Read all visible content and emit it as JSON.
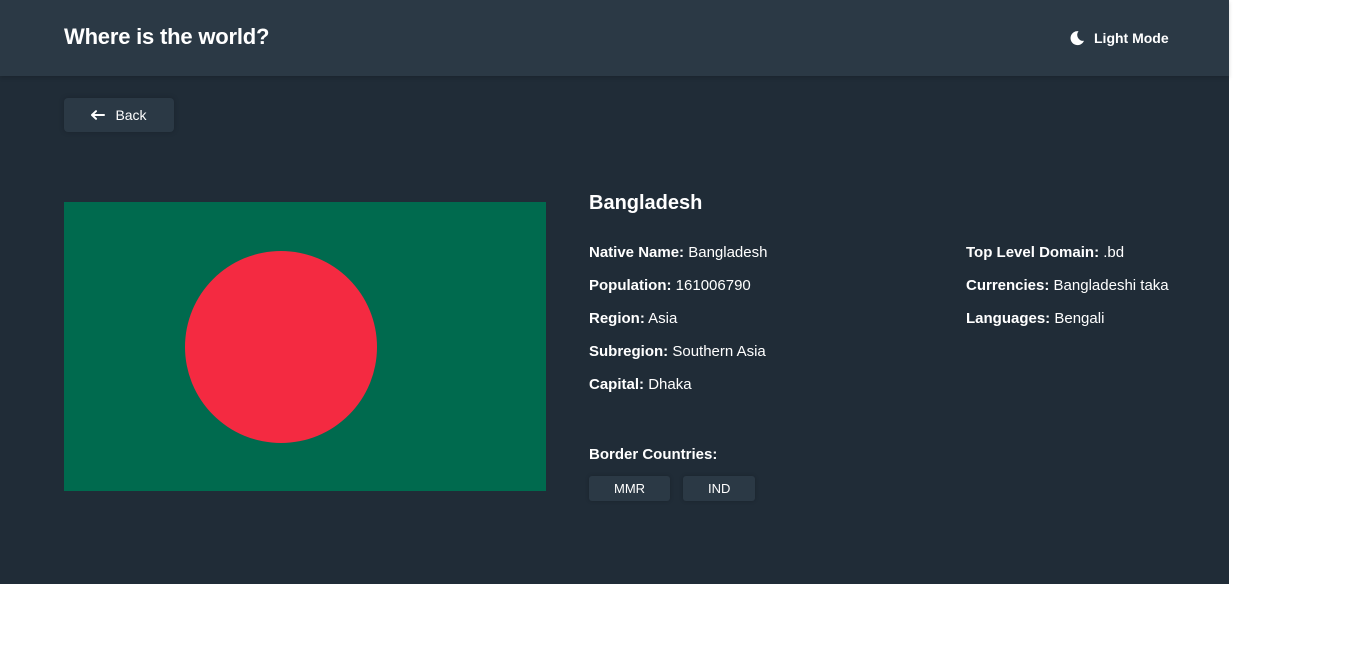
{
  "header": {
    "title": "Where is the world?",
    "mode_label": "Light Mode",
    "mode_icon": "moon-icon"
  },
  "back_button": {
    "label": "Back",
    "icon": "arrow-left-icon"
  },
  "country": {
    "name": "Bangladesh",
    "flag_colors": {
      "field": "#006a4e",
      "disc": "#f42a41"
    },
    "left_details": [
      {
        "key": "Native Name:",
        "value": "Bangladesh"
      },
      {
        "key": "Population:",
        "value": "161006790"
      },
      {
        "key": "Region:",
        "value": "Asia"
      },
      {
        "key": "Subregion:",
        "value": "Southern Asia"
      },
      {
        "key": "Capital:",
        "value": "Dhaka"
      }
    ],
    "right_details": [
      {
        "key": "Top Level Domain:",
        "value": ".bd"
      },
      {
        "key": "Currencies:",
        "value": "Bangladeshi taka"
      },
      {
        "key": "Languages:",
        "value": "Bengali"
      }
    ],
    "border_label": "Border Countries:",
    "borders": [
      "MMR",
      "IND"
    ]
  },
  "colors": {
    "background": "#202c37",
    "element": "#2b3945",
    "text": "#ffffff"
  }
}
